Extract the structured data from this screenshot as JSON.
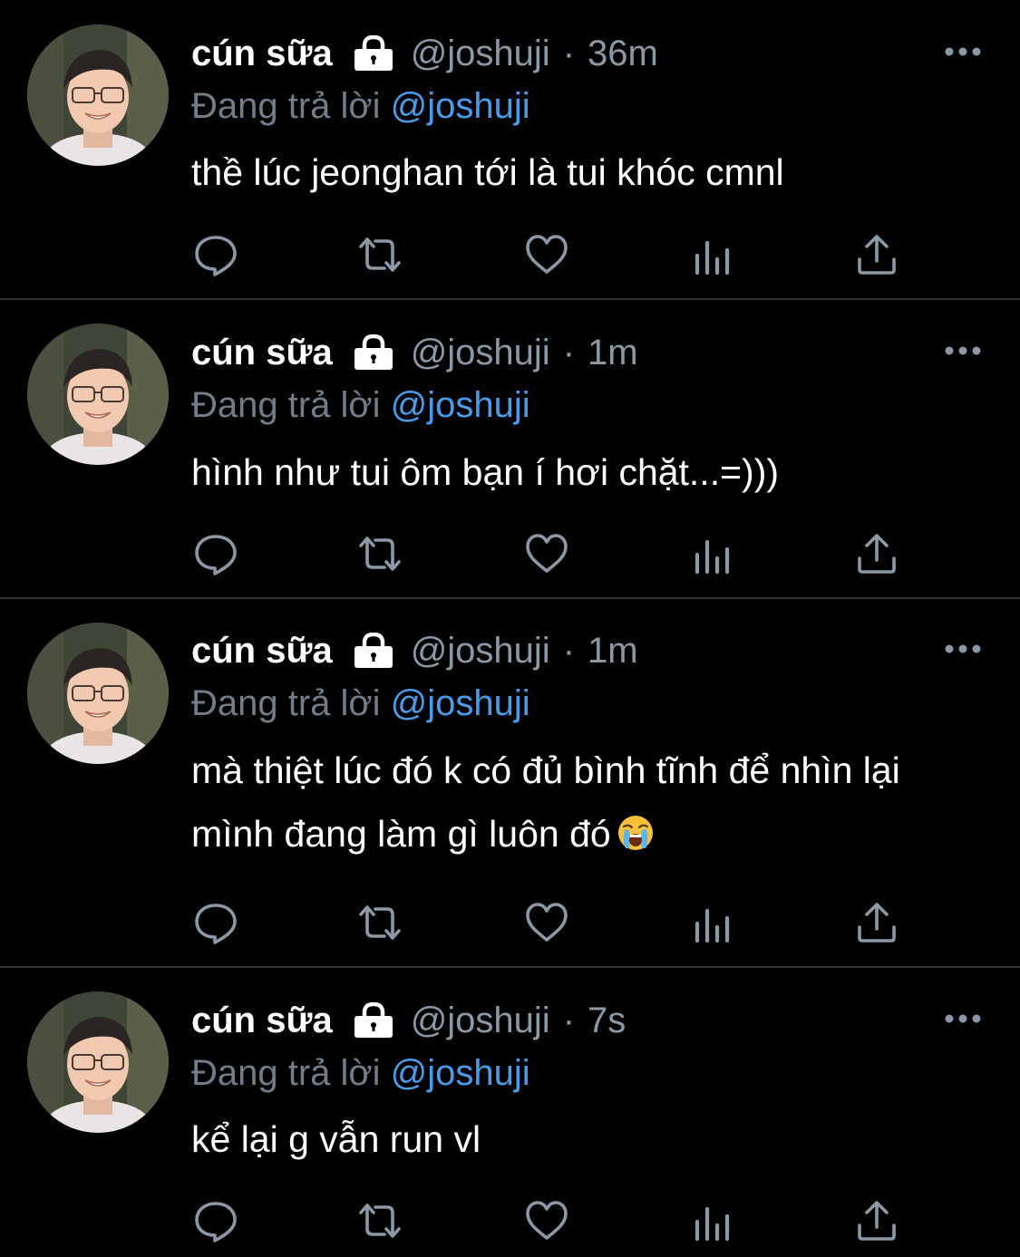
{
  "colors": {
    "background": "#000000",
    "divider": "#2f3336",
    "text_primary": "#ffffff",
    "text_secondary": "#8b98a5",
    "link": "#4a9ce8"
  },
  "tweets": [
    {
      "display_name": "cún sữa",
      "handle": "@joshuji",
      "separator": "·",
      "time": "36m",
      "reply_prefix": "Đang trả lời",
      "reply_to": "@joshuji",
      "text": "thề lúc jeonghan tới là tui khóc cmnl",
      "avatar_icon": "profile-photo",
      "protected_icon": "lock-icon"
    },
    {
      "display_name": "cún sữa",
      "handle": "@joshuji",
      "separator": "·",
      "time": "1m",
      "reply_prefix": "Đang trả lời",
      "reply_to": "@joshuji",
      "text": "hình như tui ôm bạn í hơi chặt...=)))",
      "avatar_icon": "profile-photo",
      "protected_icon": "lock-icon"
    },
    {
      "display_name": "cún sữa",
      "handle": "@joshuji",
      "separator": "·",
      "time": "1m",
      "reply_prefix": "Đang trả lời",
      "reply_to": "@joshuji",
      "text": "mà thiệt lúc đó k có đủ bình tĩnh để nhìn lại mình đang làm gì luôn đó",
      "text_emoji": "loudly-crying-face-emoji",
      "avatar_icon": "profile-photo",
      "protected_icon": "lock-icon"
    },
    {
      "display_name": "cún sữa",
      "handle": "@joshuji",
      "separator": "·",
      "time": "7s",
      "reply_prefix": "Đang trả lời",
      "reply_to": "@joshuji",
      "text": "kể lại g vẫn run vl",
      "avatar_icon": "profile-photo",
      "protected_icon": "lock-icon"
    }
  ],
  "action_icons": [
    "reply-icon",
    "retweet-icon",
    "like-icon",
    "analytics-icon",
    "share-icon"
  ],
  "more_icon": "more-options-icon"
}
